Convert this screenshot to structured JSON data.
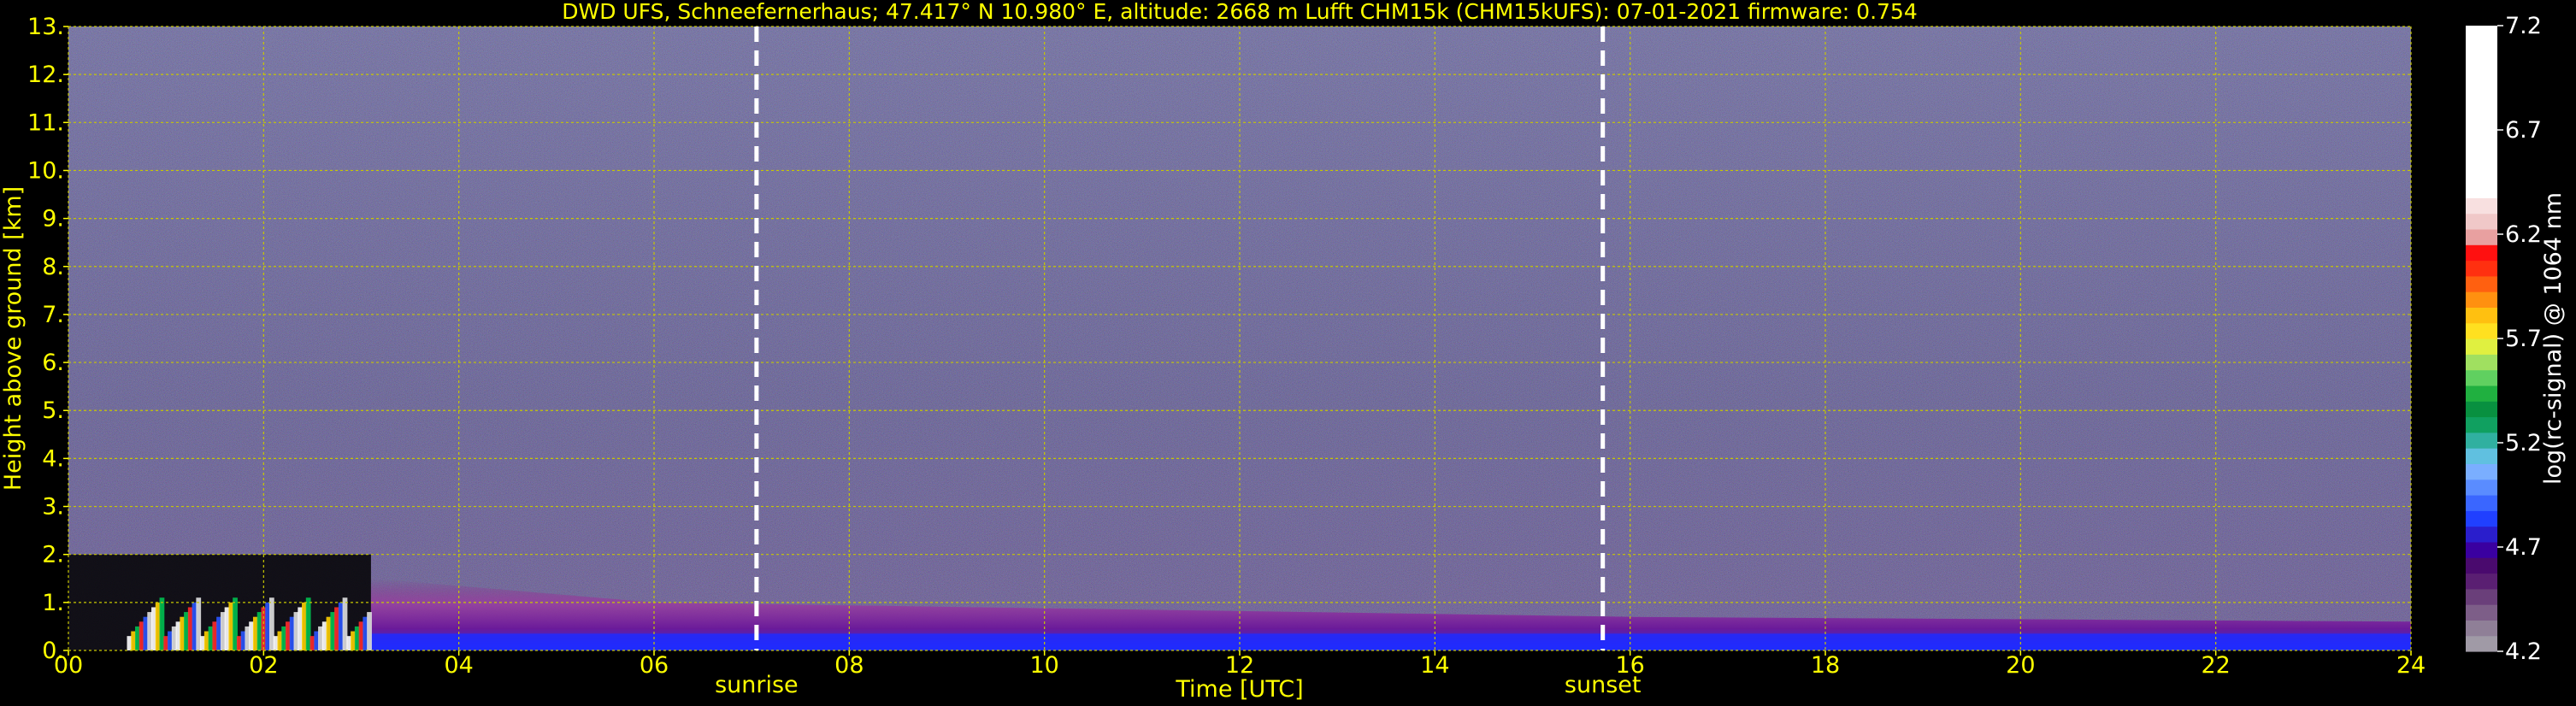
{
  "chart_data": {
    "type": "heatmap",
    "title": "DWD UFS, Schneefernerhaus; 47.417° N 10.980° E, altitude: 2668 m    Lufft CHM15k (CHM15kUFS): 07-01-2021    firmware: 0.754",
    "xlabel": "Time [UTC]",
    "ylabel": "Height above ground [km]",
    "xlim": [
      0,
      24
    ],
    "ylim": [
      0,
      13
    ],
    "x_ticks": [
      "00",
      "02",
      "04",
      "06",
      "08",
      "10",
      "12",
      "14",
      "16",
      "18",
      "20",
      "22",
      "24"
    ],
    "y_ticks": [
      "0.",
      "1.",
      "2.",
      "3.",
      "4.",
      "5.",
      "6.",
      "7.",
      "8.",
      "9.",
      "10.",
      "11.",
      "12.",
      "13."
    ],
    "grid": true,
    "annotations": [
      {
        "label": "sunrise",
        "x": 7.05
      },
      {
        "label": "sunset",
        "x": 15.72
      }
    ],
    "colorbar": {
      "label": "log(rc-signal) @ 1064 nm",
      "range": [
        4.2,
        7.2
      ],
      "ticks": [
        "4.2",
        "4.7",
        "5.2",
        "5.7",
        "6.2",
        "6.7",
        "7.2"
      ]
    },
    "background_noise_top_km": 2.0,
    "background_noise_until_hour": 3.1,
    "low_cloud_layer": {
      "from_hour": 0.6,
      "to_hour": 3.1,
      "top_km": 1.2
    },
    "aerosol_layer_top_km": [
      [
        3.1,
        1.5
      ],
      [
        6,
        1.0
      ],
      [
        11,
        0.85
      ],
      [
        16,
        0.7
      ],
      [
        24,
        0.6
      ]
    ],
    "colors": {
      "background": "#000000",
      "text": "#ffff00",
      "grid": "#c8c800",
      "marker_line": "#ffffff"
    }
  }
}
